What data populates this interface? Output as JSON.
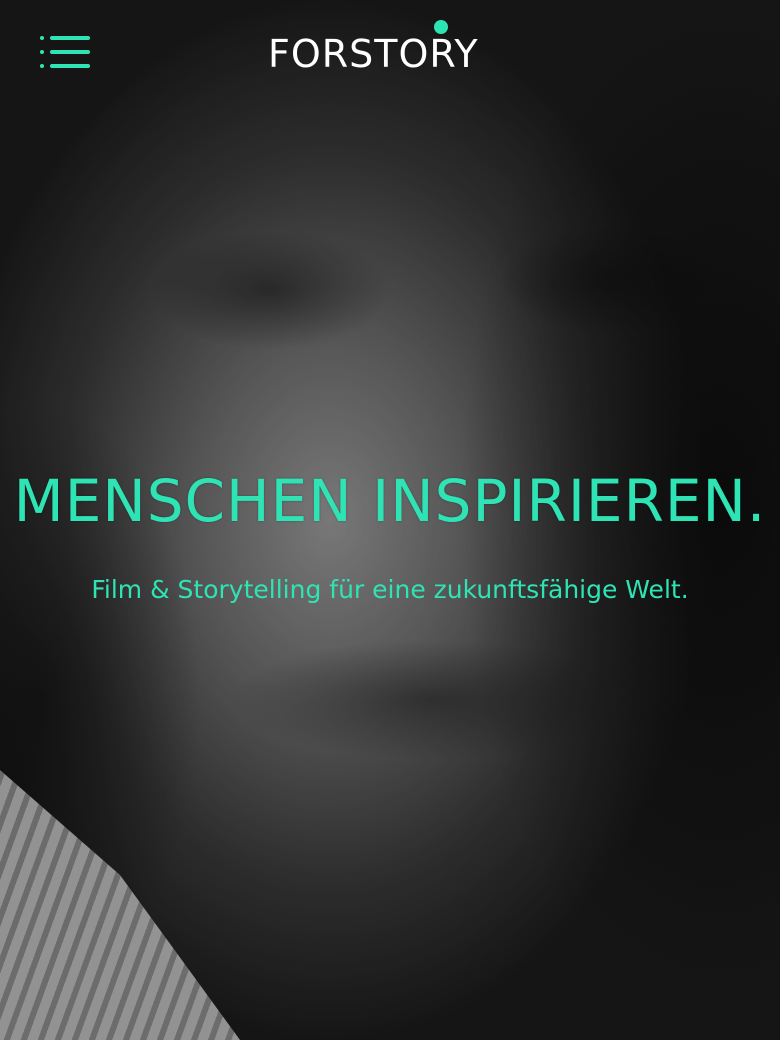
{
  "header": {
    "menu_icon": "hamburger-menu-icon",
    "logo_text": "FORSTORY"
  },
  "hero": {
    "headline": "MENSCHEN INSPIRIEREN.",
    "subline": "Film & Storytelling für eine zukunftsfähige Welt."
  },
  "colors": {
    "accent": "#2fe4b4",
    "logo": "#ffffff"
  }
}
